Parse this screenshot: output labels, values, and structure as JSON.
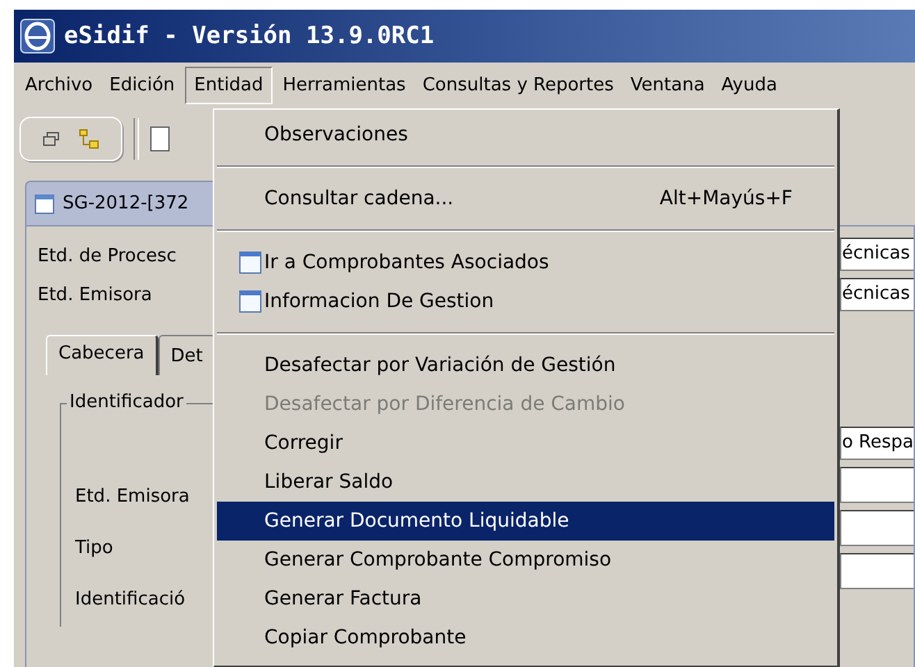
{
  "window": {
    "title": "eSidif - Versión 13.9.0RC1"
  },
  "menu_bar": [
    {
      "label": "Archivo",
      "selected": false
    },
    {
      "label": "Edición",
      "selected": false
    },
    {
      "label": "Entidad",
      "selected": true
    },
    {
      "label": "Herramientas",
      "selected": false
    },
    {
      "label": "Consultas y Reportes",
      "selected": false
    },
    {
      "label": "Ventana",
      "selected": false
    },
    {
      "label": "Ayuda",
      "selected": false
    }
  ],
  "document_tab": {
    "title": "SG-2012-[372"
  },
  "form": {
    "labels": [
      "Etd. de Procesc",
      "Etd. Emisora"
    ],
    "tabs": [
      {
        "label": "Cabecera",
        "selected": true
      },
      {
        "label": "Det",
        "selected": false
      }
    ],
    "group": {
      "title": "Identificador",
      "labels": [
        "Etd. Emisora",
        "Tipo",
        "Identificació"
      ]
    }
  },
  "right_fields": [
    {
      "kind": "text",
      "value": "écnicas"
    },
    {
      "kind": "text",
      "value": "écnicas"
    },
    {
      "kind": "text",
      "value": "o Respa"
    },
    {
      "kind": "blank"
    },
    {
      "kind": "blank"
    },
    {
      "kind": "blank"
    }
  ],
  "dropdown_menu": {
    "sections": [
      {
        "items": [
          {
            "kind": "plain",
            "label": "Observaciones",
            "selected": false,
            "disabled": false
          }
        ]
      },
      {
        "items": [
          {
            "kind": "plain",
            "label": "Consultar cadena...",
            "shortcut": "Alt+Mayús+F",
            "selected": false,
            "disabled": false
          }
        ]
      },
      {
        "items": [
          {
            "kind": "with-icon",
            "label": "Ir a Comprobantes Asociados",
            "selected": false,
            "disabled": false
          },
          {
            "kind": "with-icon",
            "label": "Informacion De Gestion",
            "selected": false,
            "disabled": false
          }
        ]
      },
      {
        "items": [
          {
            "kind": "plain",
            "label": "Desafectar por Variación de Gestión",
            "selected": false,
            "disabled": false
          },
          {
            "kind": "plain",
            "label": "Desafectar por Diferencia de Cambio",
            "selected": false,
            "disabled": true
          },
          {
            "kind": "plain",
            "label": "Corregir",
            "selected": false,
            "disabled": false
          },
          {
            "kind": "plain",
            "label": "Liberar Saldo",
            "selected": false,
            "disabled": false
          },
          {
            "kind": "plain",
            "label": "Generar Documento Liquidable",
            "selected": true,
            "disabled": false
          },
          {
            "kind": "plain",
            "label": "Generar Comprobante Compromiso",
            "selected": false,
            "disabled": false
          },
          {
            "kind": "plain",
            "label": "Generar Factura",
            "selected": false,
            "disabled": false
          },
          {
            "kind": "plain",
            "label": "Copiar Comprobante",
            "selected": false,
            "disabled": false
          }
        ]
      }
    ]
  }
}
